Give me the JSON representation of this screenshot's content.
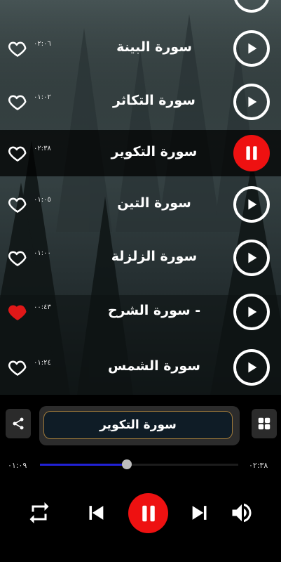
{
  "tracks": [
    {
      "title": "سورة البينة",
      "duration": "٠٢:٠٦",
      "favorite": false,
      "playing": false
    },
    {
      "title": "سورة التكاثر",
      "duration": "٠١:٠٢",
      "favorite": false,
      "playing": false
    },
    {
      "title": "سورة التكوير",
      "duration": "٠٢:٣٨",
      "favorite": false,
      "playing": true
    },
    {
      "title": "سورة التين",
      "duration": "٠١:٠٥",
      "favorite": false,
      "playing": false
    },
    {
      "title": "سورة الزلزلة",
      "duration": "٠١:٠٠",
      "favorite": false,
      "playing": false
    },
    {
      "title": "سورة الشرح -",
      "duration": "٠٠:٤٣",
      "favorite": true,
      "playing": false
    },
    {
      "title": "سورة الشمس",
      "duration": "٠١:٢٤",
      "favorite": false,
      "playing": false
    }
  ],
  "player": {
    "now_playing": "سورة التكوير",
    "elapsed": "٠١:٠٩",
    "total": "٠٢:٣٨",
    "progress": 0.437
  },
  "colors": {
    "accent_red": "#ee1111",
    "progress_blue": "#2121d6",
    "favorite_red": "#e01818"
  },
  "icons": {
    "share": "share-icon",
    "grid": "grid-icon",
    "repeat": "repeat-icon",
    "previous": "skip-previous-icon",
    "pause": "pause-icon",
    "next": "skip-next-icon",
    "volume": "volume-icon"
  }
}
